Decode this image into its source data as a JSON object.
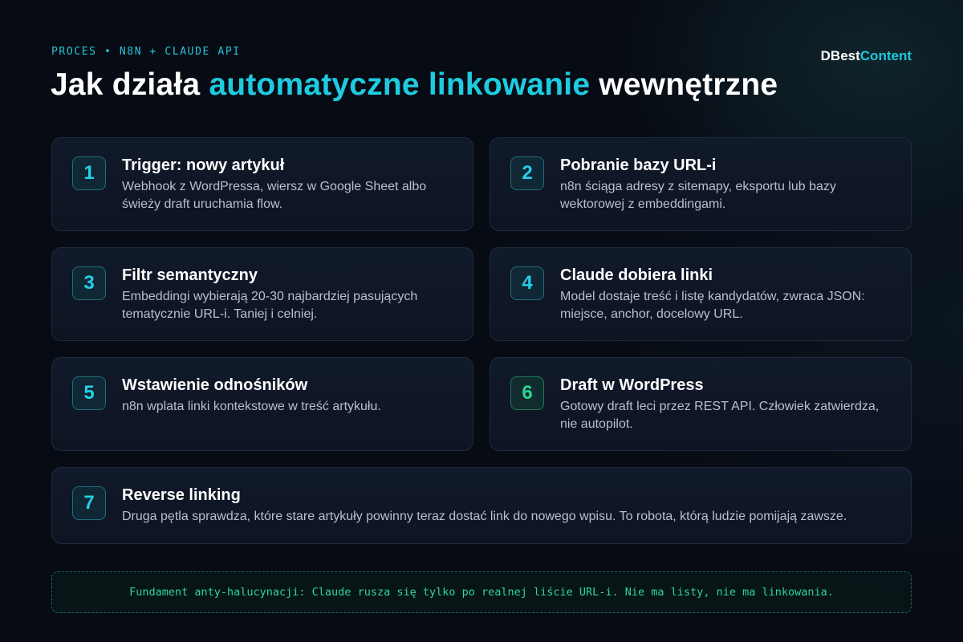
{
  "header": {
    "eyebrow": "PROCES • N8N + CLAUDE API",
    "brand_part1": "DBest",
    "brand_part2": "Content",
    "title_part1": "Jak działa ",
    "title_accent": "automatyczne linkowanie",
    "title_part2": " wewnętrzne"
  },
  "colors": {
    "background": "#070b13",
    "accent_cyan": "#1ecbe0",
    "accent_green": "#2bd690",
    "card_background": "#111a2a"
  },
  "steps": [
    {
      "number": "1",
      "title": "Trigger: nowy artykuł",
      "description": "Webhook z WordPressa, wiersz w Google Sheet albo świeży draft uruchamia flow."
    },
    {
      "number": "2",
      "title": "Pobranie bazy URL-i",
      "description": "n8n ściąga adresy z sitemapy, eksportu lub bazy wektorowej z embeddingami."
    },
    {
      "number": "3",
      "title": "Filtr semantyczny",
      "description": "Embeddingi wybierają 20-30 najbardziej pasujących tematycznie URL-i. Taniej i celniej."
    },
    {
      "number": "4",
      "title": "Claude dobiera linki",
      "description": "Model dostaje treść i listę kandydatów, zwraca JSON: miejsce, anchor, docelowy URL."
    },
    {
      "number": "5",
      "title": "Wstawienie odnośników",
      "description": "n8n wplata linki kontekstowe w treść artykułu."
    },
    {
      "number": "6",
      "title": "Draft w WordPress",
      "description": "Gotowy draft leci przez REST API. Człowiek zatwierdza, nie autopilot."
    },
    {
      "number": "7",
      "title": "Reverse linking",
      "description": "Druga pętla sprawdza, które stare artykuły powinny teraz dostać link do nowego wpisu. To robota, którą ludzie pomijają zawsze."
    }
  ],
  "footer_note": "Fundament anty-halucynacji: Claude rusza się tylko po realnej liście URL-i. Nie ma listy, nie ma linkowania."
}
